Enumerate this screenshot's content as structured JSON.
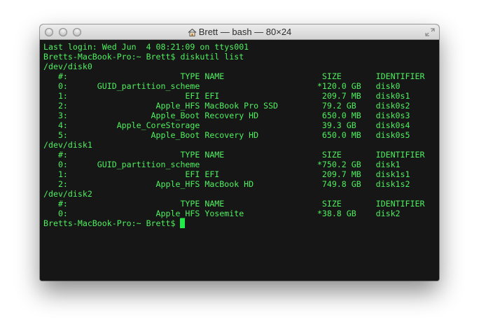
{
  "window": {
    "title": "Brett — bash — 80×24"
  },
  "terminal": {
    "lines": [
      "Last login: Wed Jun  4 08:21:09 on ttys001",
      "Bretts-MacBook-Pro:~ Brett$ diskutil list",
      "/dev/disk0",
      "   #:                       TYPE NAME                    SIZE       IDENTIFIER",
      "   0:      GUID_partition_scheme                        *120.0 GB   disk0",
      "   1:                        EFI EFI                     209.7 MB   disk0s1",
      "   2:                  Apple_HFS MacBook Pro SSD         79.2 GB    disk0s2",
      "   3:                 Apple_Boot Recovery HD             650.0 MB   disk0s3",
      "   4:          Apple_CoreStorage                         39.3 GB    disk0s4",
      "   5:                 Apple_Boot Recovery HD             650.0 MB   disk0s5",
      "/dev/disk1",
      "   #:                       TYPE NAME                    SIZE       IDENTIFIER",
      "   0:      GUID_partition_scheme                        *750.2 GB   disk1",
      "   1:                        EFI EFI                     209.7 MB   disk1s1",
      "   2:                  Apple_HFS MacBook HD              749.8 GB   disk1s2",
      "/dev/disk2",
      "   #:                       TYPE NAME                    SIZE       IDENTIFIER",
      "   0:                  Apple_HFS Yosemite               *38.8 GB    disk2"
    ],
    "prompt": "Bretts-MacBook-Pro:~ Brett$ "
  },
  "colors": {
    "text": "#4ff05f",
    "cursor": "#20ee48",
    "background": "#161616"
  },
  "icons": [
    "home-icon",
    "fullscreen-icon",
    "close-button",
    "minimize-button",
    "zoom-button"
  ]
}
